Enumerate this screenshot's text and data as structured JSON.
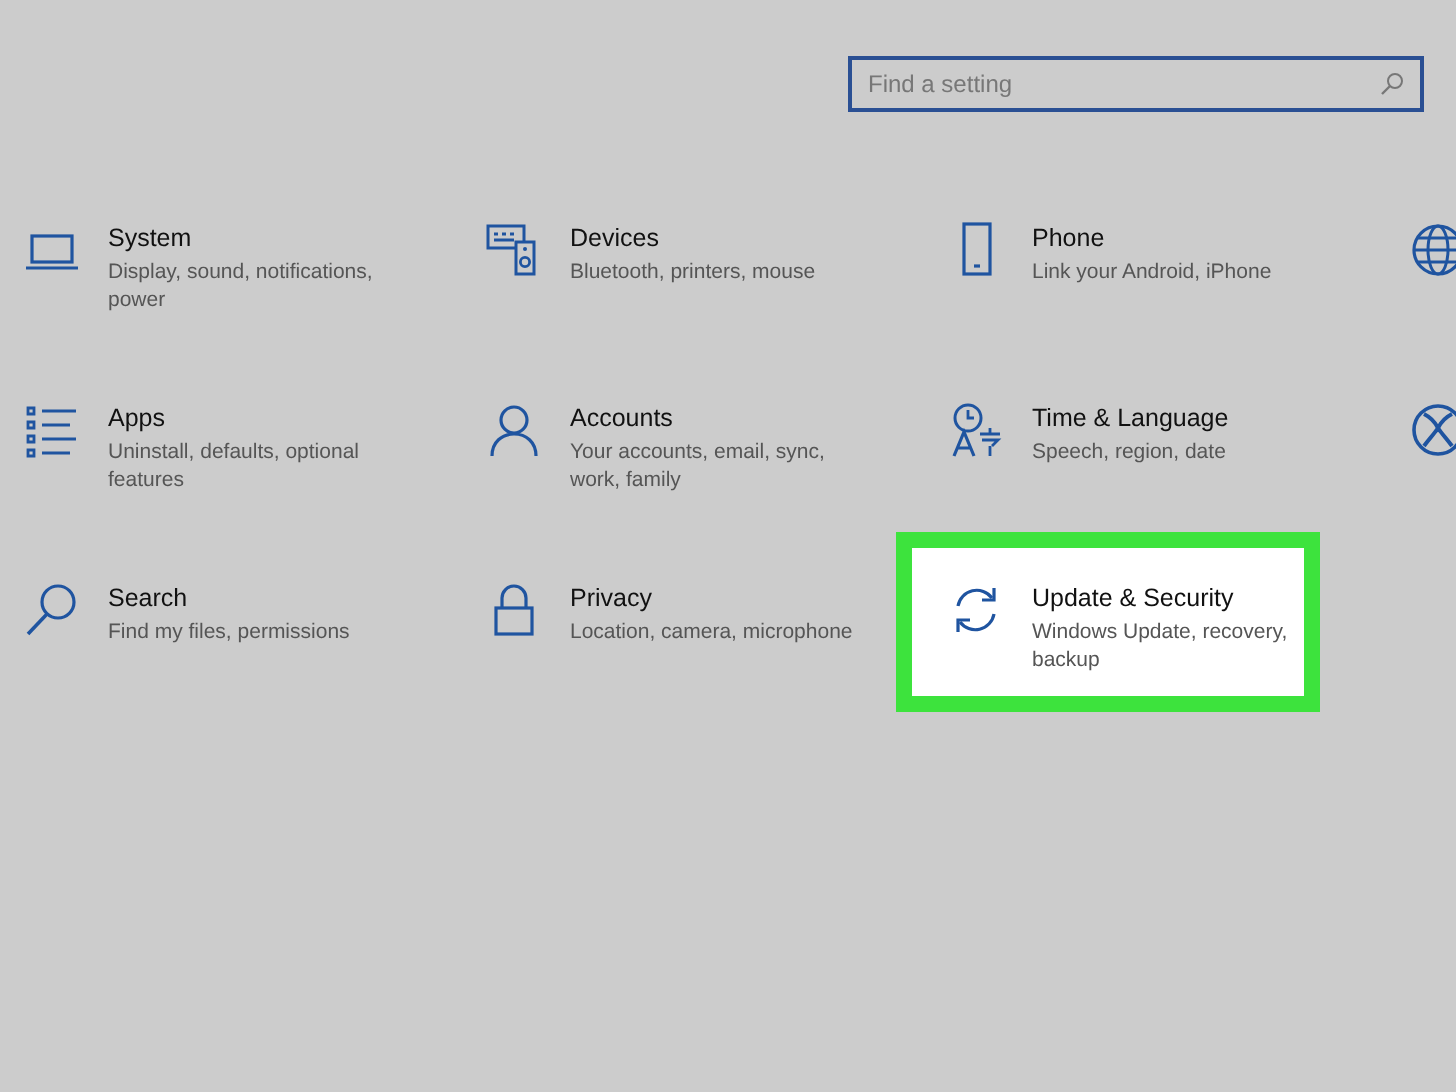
{
  "search": {
    "placeholder": "Find a setting"
  },
  "tiles": [
    {
      "kind": "system",
      "title": "System",
      "description": "Display, sound, notifications, power",
      "selected": false
    },
    {
      "kind": "devices",
      "title": "Devices",
      "description": "Bluetooth, printers, mouse",
      "selected": false
    },
    {
      "kind": "phone",
      "title": "Phone",
      "description": "Link your Android, iPhone",
      "selected": false
    },
    {
      "kind": "network",
      "selected": false
    },
    {
      "kind": "apps",
      "title": "Apps",
      "description": "Uninstall, defaults, optional features",
      "selected": false
    },
    {
      "kind": "accounts",
      "title": "Accounts",
      "description": "Your accounts, email, sync, work, family",
      "selected": false
    },
    {
      "kind": "time",
      "title": "Time & Language",
      "description": "Speech, region, date",
      "selected": false
    },
    {
      "kind": "gaming",
      "selected": false
    },
    {
      "kind": "search",
      "title": "Search",
      "description": "Find my files, permissions",
      "selected": false
    },
    {
      "kind": "privacy",
      "title": "Privacy",
      "description": "Location, camera, microphone",
      "selected": false
    },
    {
      "kind": "update",
      "title": "Update & Security",
      "description": "Windows Update, recovery, backup",
      "selected": true
    }
  ]
}
